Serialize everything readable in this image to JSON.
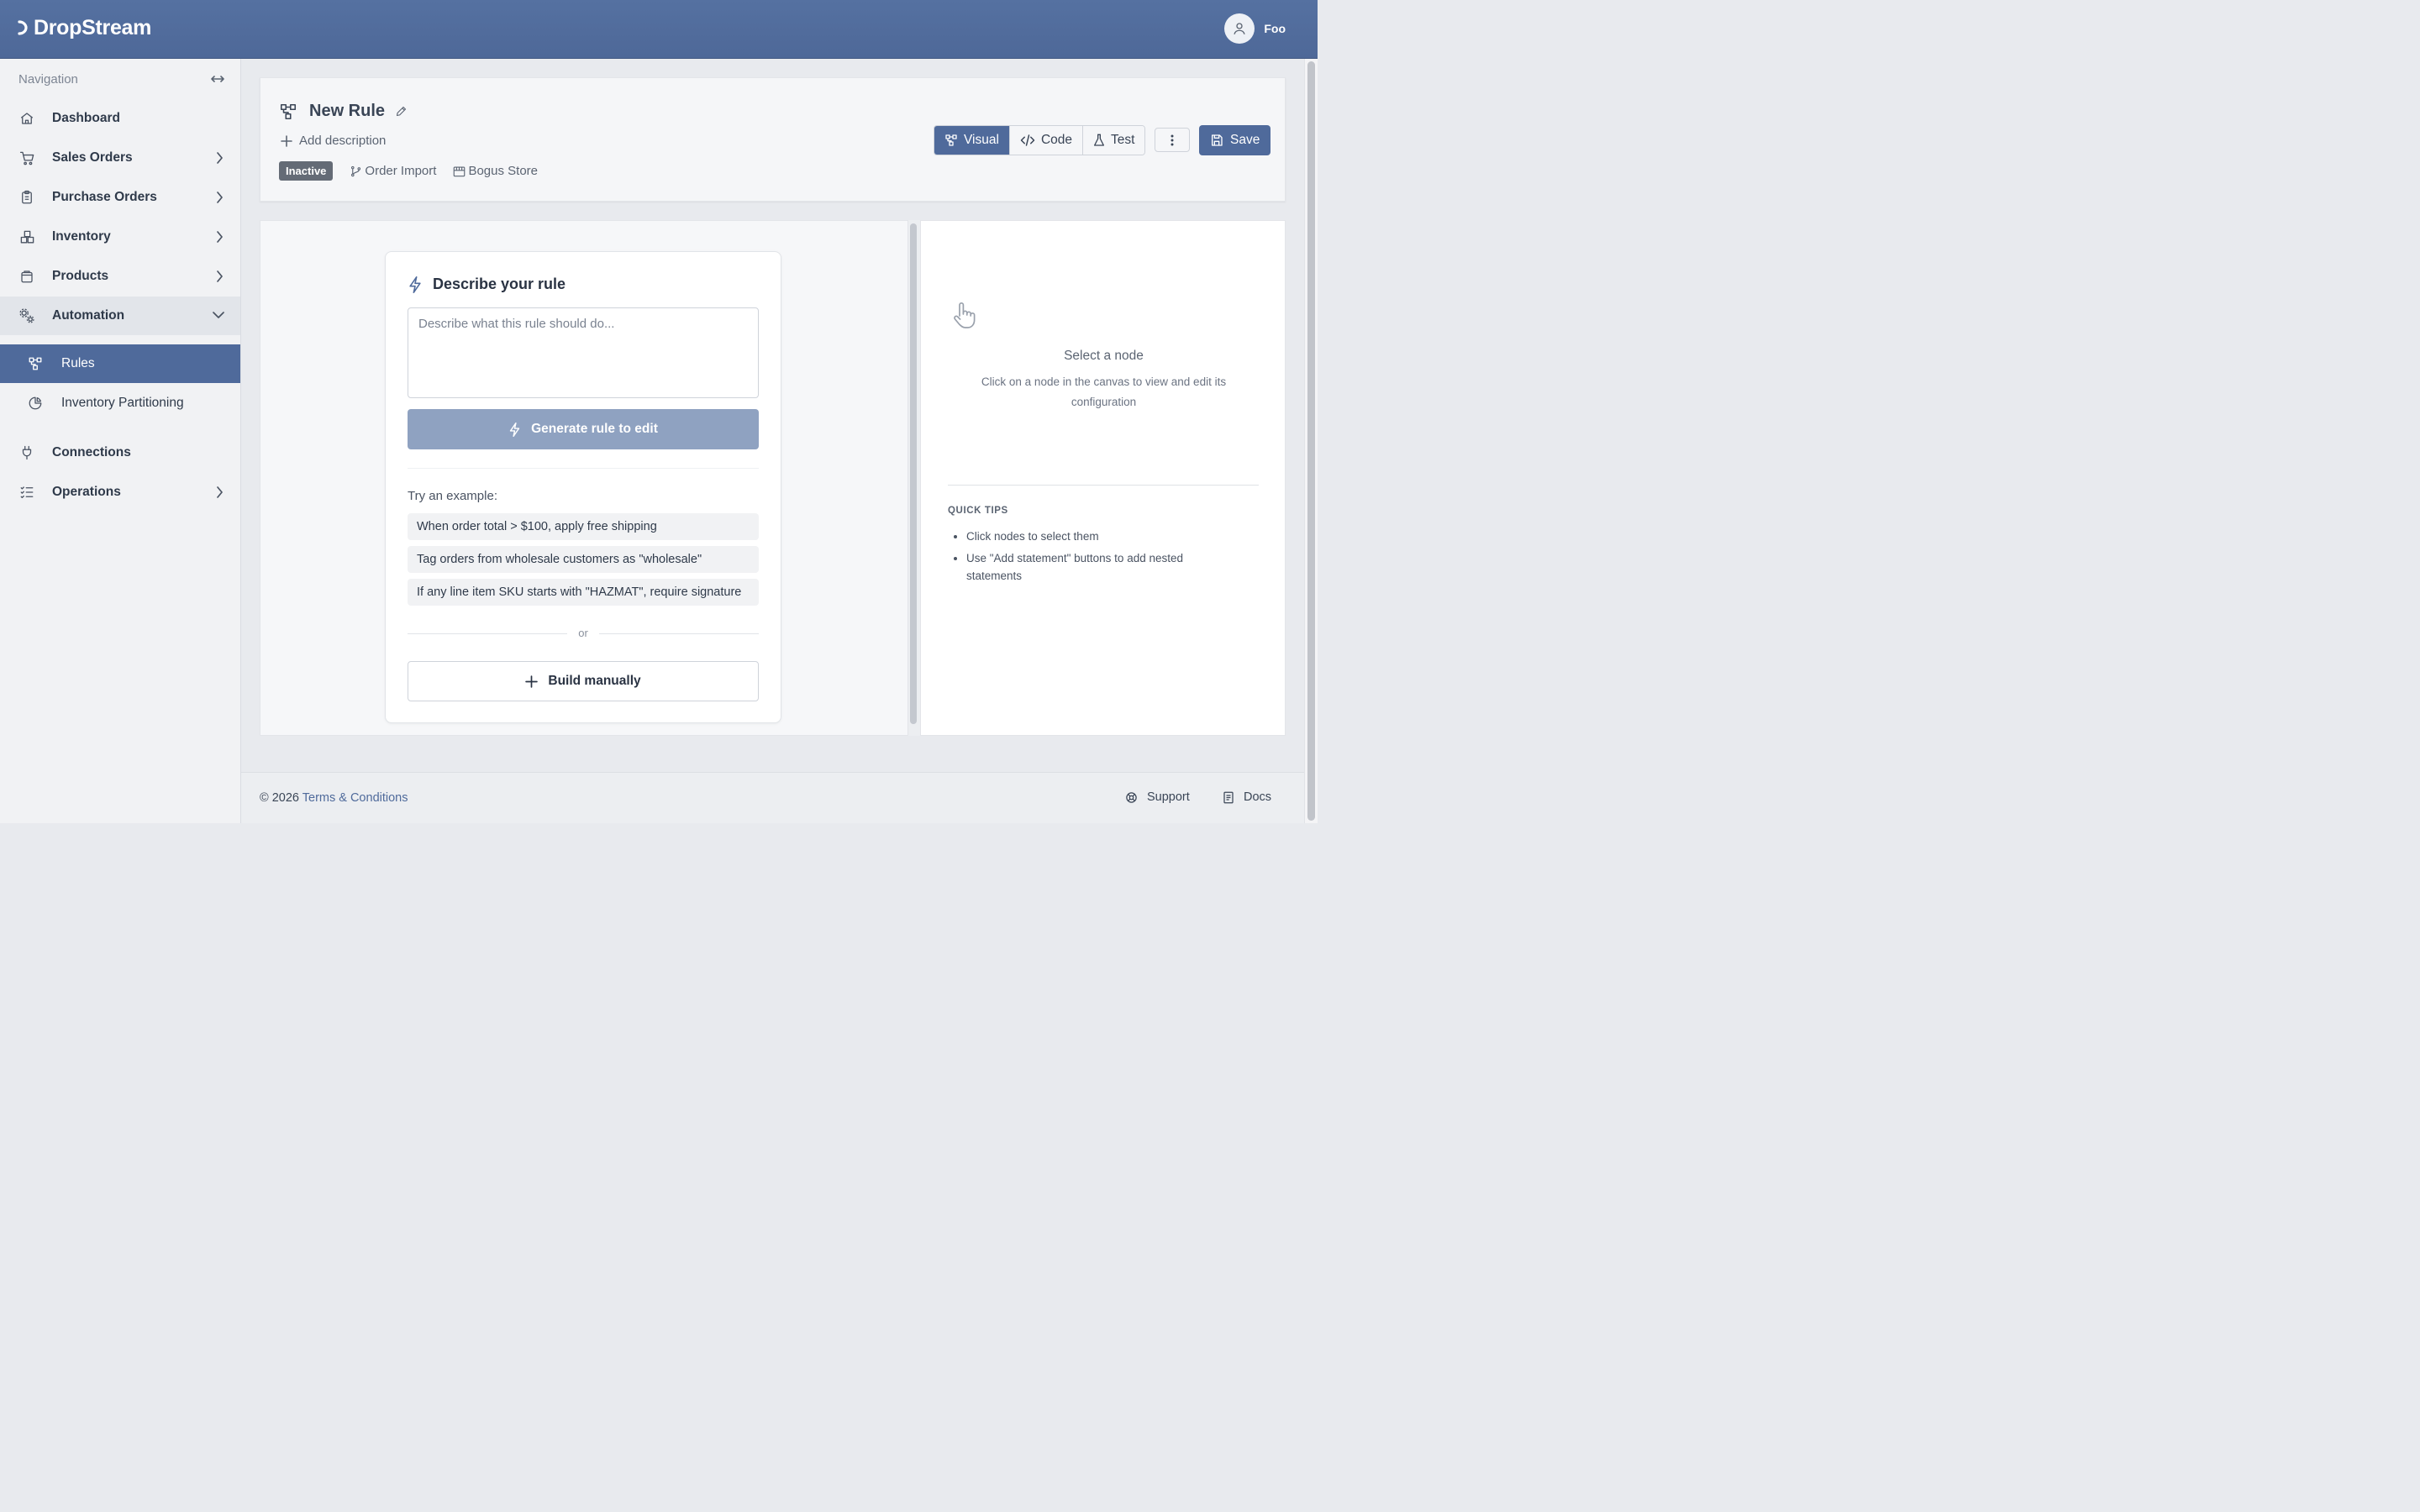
{
  "app": {
    "name": "DropStream",
    "user_name": "Foo"
  },
  "sidebar": {
    "title": "Navigation",
    "items": [
      {
        "label": "Dashboard"
      },
      {
        "label": "Sales Orders"
      },
      {
        "label": "Purchase Orders"
      },
      {
        "label": "Inventory"
      },
      {
        "label": "Products"
      },
      {
        "label": "Automation"
      },
      {
        "label": "Connections"
      },
      {
        "label": "Operations"
      }
    ],
    "sub_items": [
      {
        "label": "Rules"
      },
      {
        "label": "Inventory Partitioning"
      }
    ]
  },
  "rule": {
    "title": "New Rule",
    "add_description": "Add description",
    "status": "Inactive",
    "trigger": "Order Import",
    "store": "Bogus Store"
  },
  "toolbar": {
    "visual_label": "Visual",
    "code_label": "Code",
    "test_label": "Test",
    "save_label": "Save"
  },
  "builder": {
    "title": "Describe your rule",
    "placeholder": "Describe what this rule should do...",
    "generate_label": "Generate rule to edit",
    "try_label": "Try an example:",
    "examples": [
      "When order total > $100, apply free shipping",
      "Tag orders from wholesale customers as \"wholesale\"",
      "If any line item SKU starts with \"HAZMAT\", require signature"
    ],
    "or_label": "or",
    "build_label": "Build manually"
  },
  "panel": {
    "title": "Select a node",
    "subtitle": "Click on a node in the canvas to view and edit its configuration",
    "tips_title": "QUICK TIPS",
    "tips": [
      "Click nodes to select them",
      "Use \"Add statement\" buttons to add nested statements"
    ]
  },
  "footer": {
    "copyright": "© 2026",
    "terms": "Terms & Conditions",
    "support": "Support",
    "docs": "Docs"
  },
  "colors": {
    "brand": "#4f6a9b",
    "header": "#5571a1",
    "generate_disabled": "#8fa2c1"
  }
}
